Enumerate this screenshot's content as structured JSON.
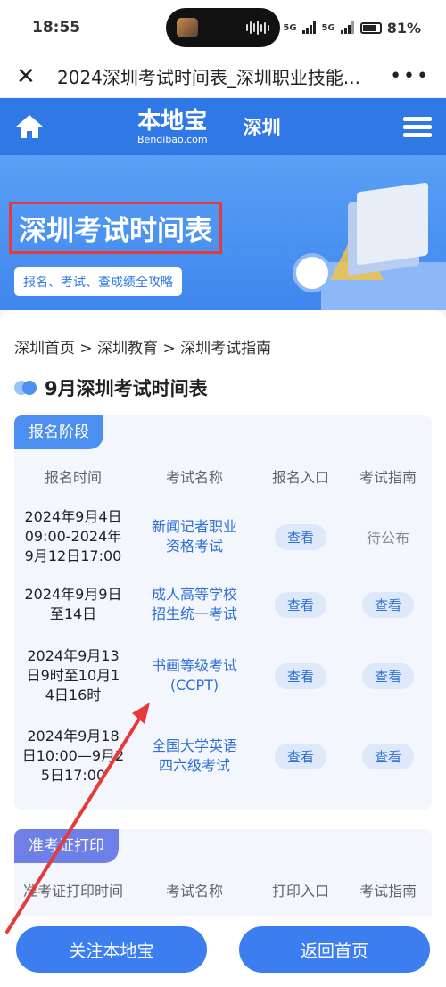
{
  "status": {
    "time": "18:55",
    "net1": "5G",
    "net2": "5G",
    "battery": "81%"
  },
  "browser": {
    "title": "2024深圳考试时间表_深圳职业技能..."
  },
  "nav": {
    "logo_main": "本地宝",
    "logo_sub": "Bendibao.com",
    "city": "深圳"
  },
  "banner": {
    "title": "深圳考试时间表",
    "subtitle": "报名、考试、查成绩全攻略"
  },
  "breadcrumb": "深圳首页 > 深圳教育 > 深圳考试指南",
  "section_title": "9月深圳考试时间表",
  "registration": {
    "tag": "报名阶段",
    "headers": [
      "报名时间",
      "考试名称",
      "报名入口",
      "考试指南"
    ],
    "rows": [
      {
        "time": "2024年9月4日\n09:00-2024年\n9月12日17:00",
        "name": "新闻记者职业\n资格考试",
        "entry": "查看",
        "guide": "待公布"
      },
      {
        "time": "2024年9月9日\n至14日",
        "name": "成人高等学校\n招生统一考试",
        "entry": "查看",
        "guide": "查看"
      },
      {
        "time": "2024年9月13\n日9时至10月1\n4日16时",
        "name": "书画等级考试\n(CCPT)",
        "entry": "查看",
        "guide": "查看"
      },
      {
        "time": "2024年9月18\n日10:00—9月2\n5日17:00",
        "name": "全国大学英语\n四六级考试",
        "entry": "查看",
        "guide": "查看"
      }
    ]
  },
  "admission": {
    "tag": "准考证打印",
    "headers": [
      "准考证打印时间",
      "考试名称",
      "打印入口",
      "考试指南"
    ]
  },
  "bottom": {
    "follow": "关注本地宝",
    "home": "返回首页"
  },
  "colors": {
    "primary": "#2f78e6",
    "button": "#3c7ef0",
    "highlight_box": "#e43c3c",
    "annotation_arrow": "#e43c3c"
  }
}
